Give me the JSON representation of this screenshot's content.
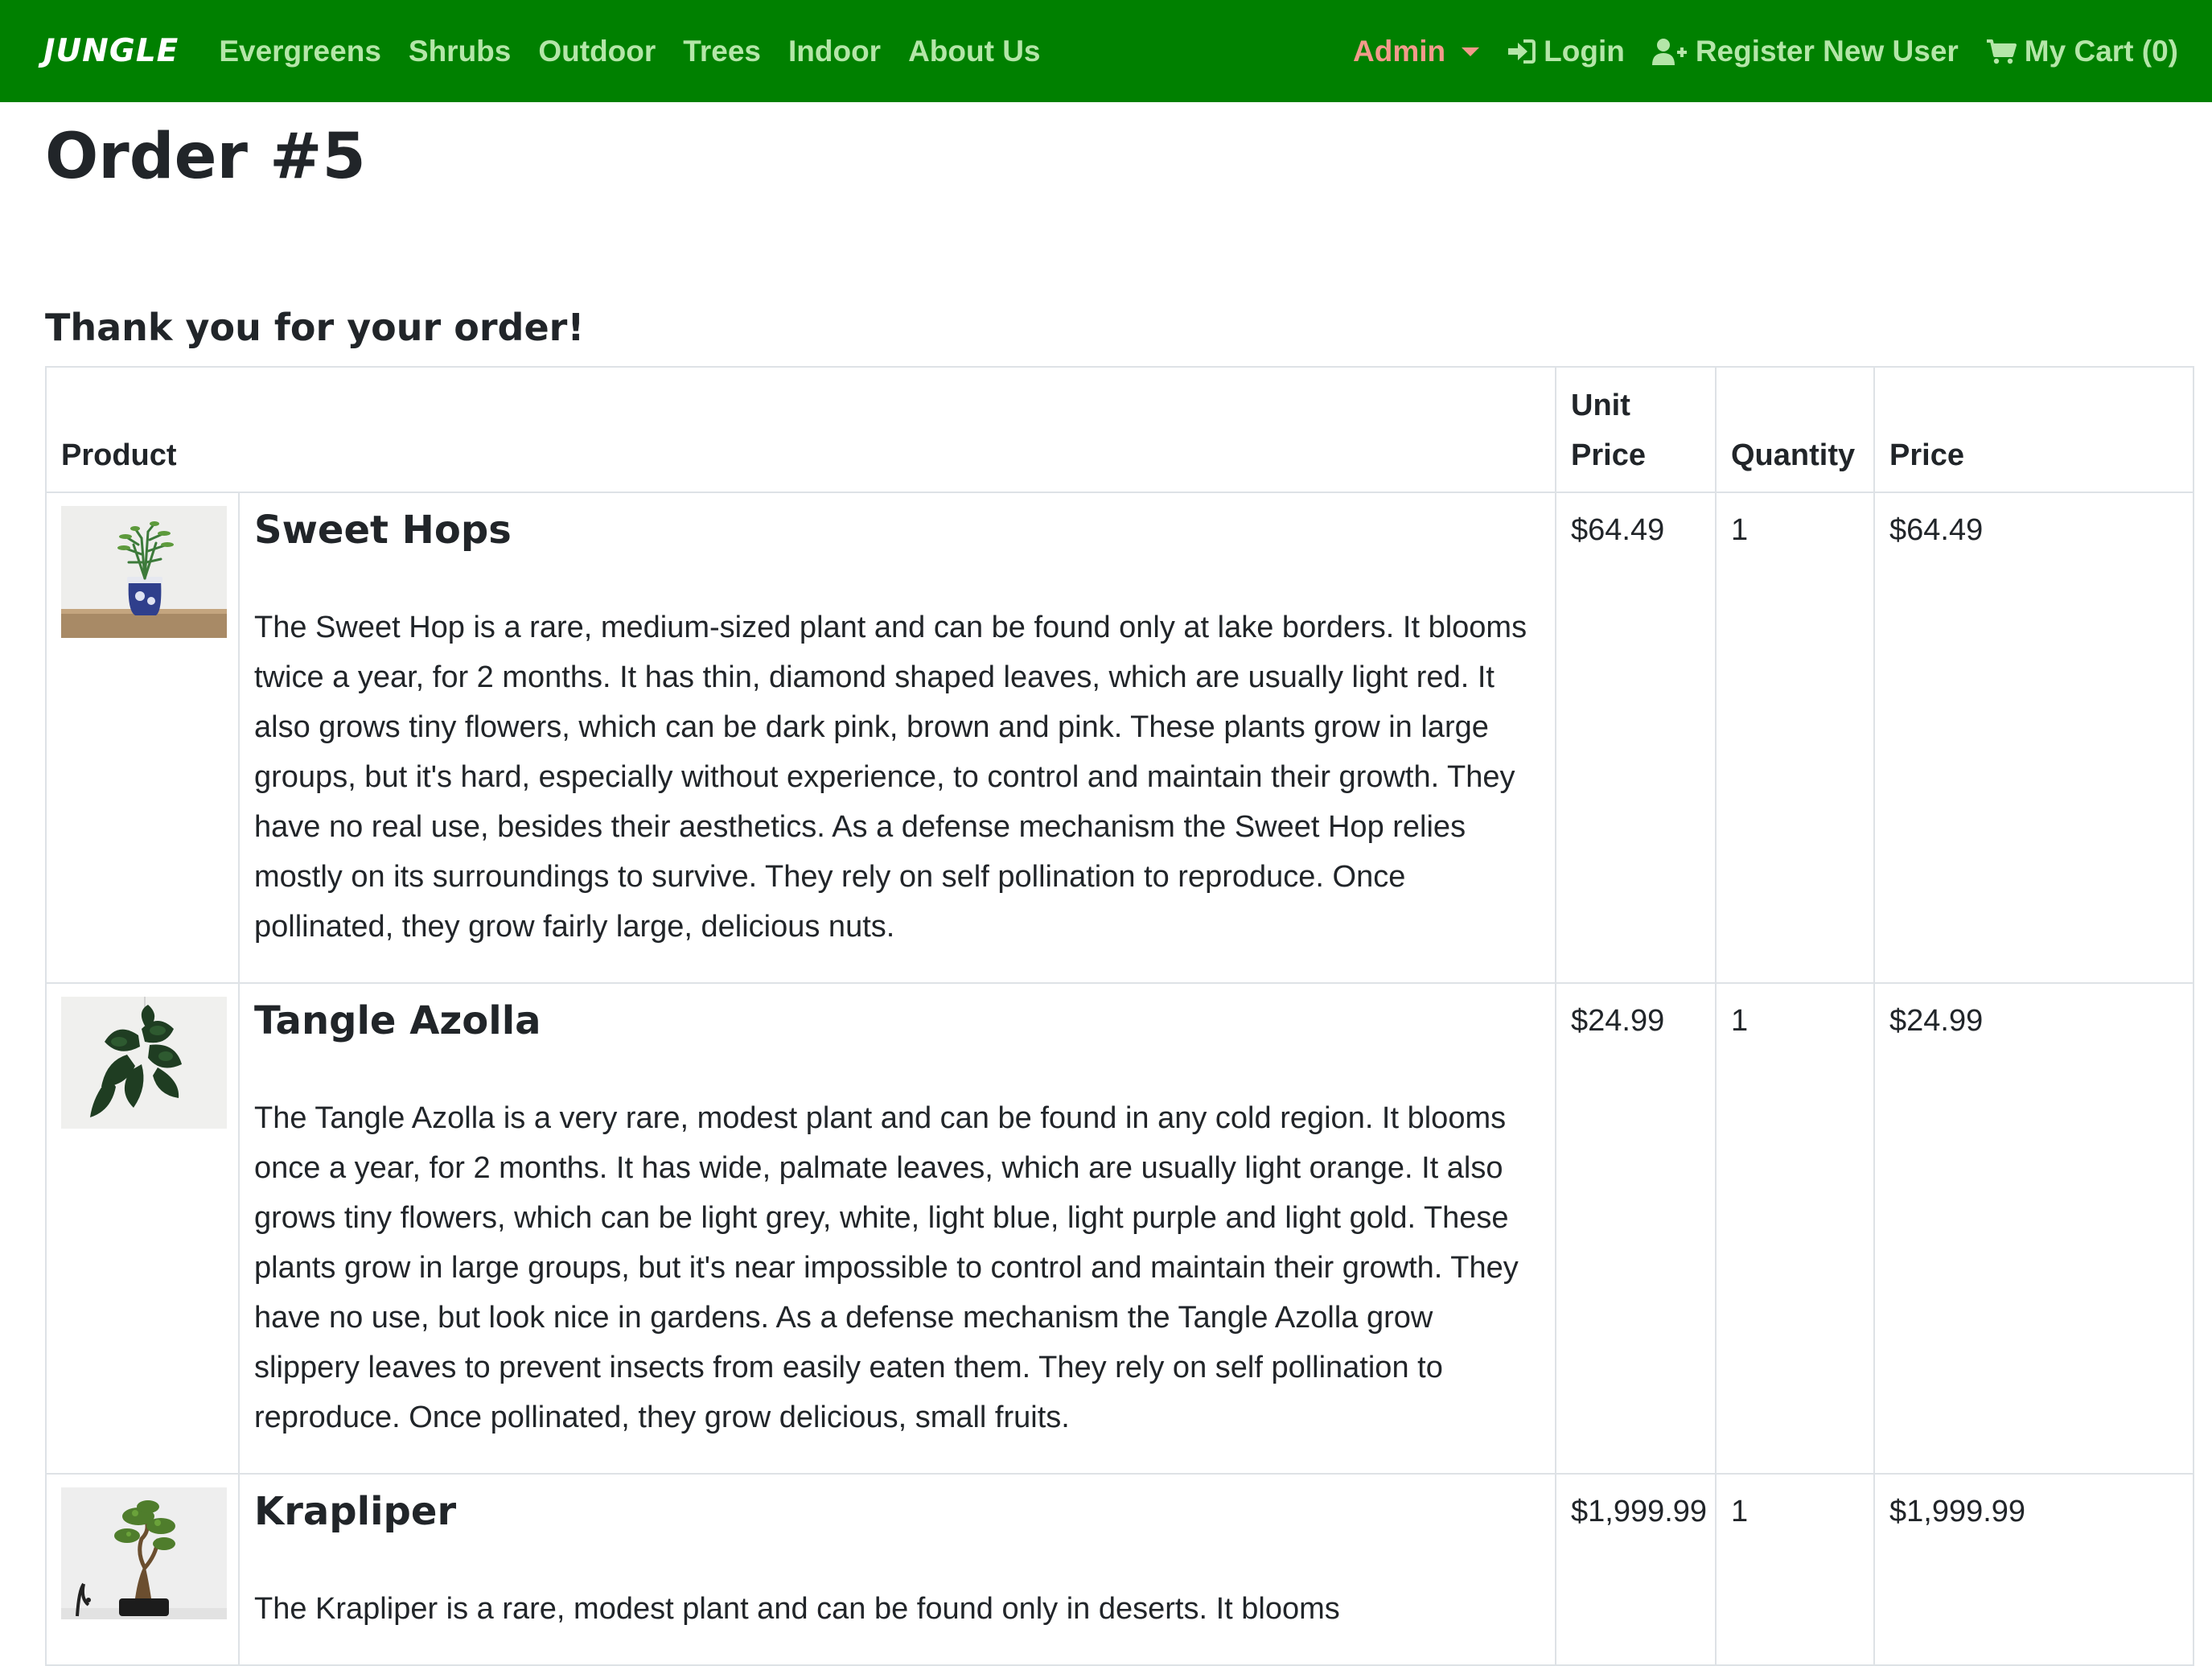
{
  "navbar": {
    "brand": "JUNGLE",
    "links": [
      "Evergreens",
      "Shrubs",
      "Outdoor",
      "Trees",
      "Indoor",
      "About Us"
    ],
    "admin_label": "Admin",
    "login_label": "Login",
    "register_label": "Register New User",
    "cart_label": "My Cart (0)",
    "colors": {
      "bar": "#008000",
      "link": "#b4e6a8",
      "admin": "#f29a8a",
      "brand": "#ffffff"
    }
  },
  "page": {
    "title": "Order #5",
    "thanks": "Thank you for your order!"
  },
  "table": {
    "headers": {
      "product": "Product",
      "unit_price": "Unit\nPrice",
      "quantity": "Quantity",
      "price": "Price"
    },
    "rows": [
      {
        "name": "Sweet Hops",
        "image_icon": "potted-plant-photo",
        "description": "The Sweet Hop is a rare, medium-sized plant and can be found only at lake borders. It blooms twice a year, for 2 months. It has thin, diamond shaped leaves, which are usually light red. It also grows tiny flowers, which can be dark pink, brown and pink. These plants grow in large groups, but it's hard, especially without experience, to control and maintain their growth. They have no real use, besides their aesthetics. As a defense mechanism the Sweet Hop relies mostly on its surroundings to survive. They rely on self pollination to reproduce. Once pollinated, they grow fairly large, delicious nuts.",
        "unit_price": "$64.49",
        "quantity": "1",
        "price": "$64.49"
      },
      {
        "name": "Tangle Azolla",
        "image_icon": "hanging-plant-photo",
        "description": "The Tangle Azolla is a very rare, modest plant and can be found in any cold region. It blooms once a year, for 2 months. It has wide, palmate leaves, which are usually light orange. It also grows tiny flowers, which can be light grey, white, light blue, light purple and light gold. These plants grow in large groups, but it's near impossible to control and maintain their growth. They have no use, but look nice in gardens. As a defense mechanism the Tangle Azolla grow slippery leaves to prevent insects from easily eaten them. They rely on self pollination to reproduce. Once pollinated, they grow delicious, small fruits.",
        "unit_price": "$24.99",
        "quantity": "1",
        "price": "$24.99"
      },
      {
        "name": "Krapliper",
        "image_icon": "bonsai-plant-photo",
        "description": "The Krapliper is a rare, modest plant and can be found only in deserts. It blooms",
        "unit_price": "$1,999.99",
        "quantity": "1",
        "price": "$1,999.99"
      }
    ]
  }
}
